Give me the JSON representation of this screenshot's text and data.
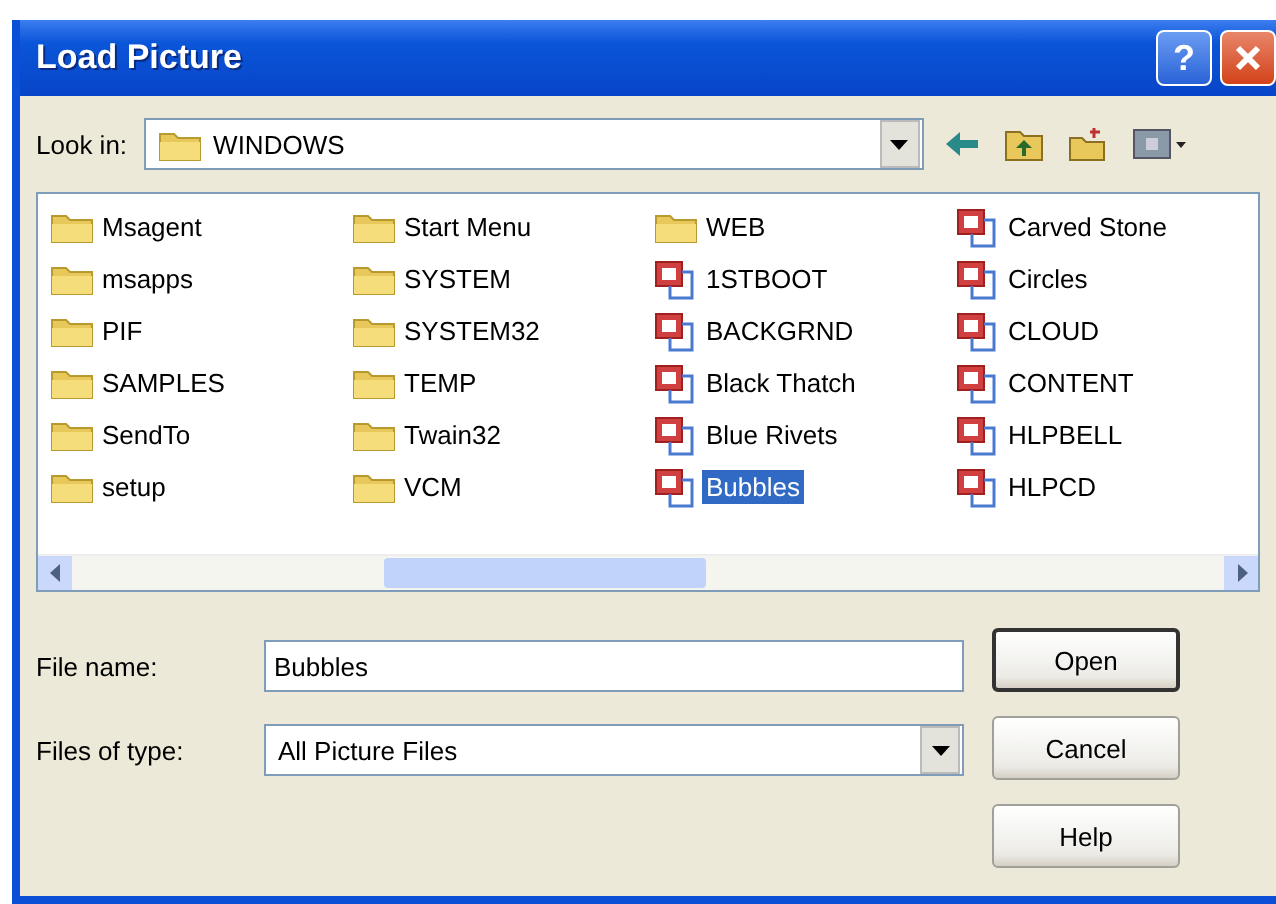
{
  "window": {
    "title": "Load Picture",
    "buttons": [
      {
        "kind": "help",
        "label": "?"
      },
      {
        "kind": "close"
      }
    ]
  },
  "toolbar": {
    "look_in_label": "Look in:",
    "look_in_value": "WINDOWS",
    "tools": [
      {
        "kind": "back"
      },
      {
        "kind": "up"
      },
      {
        "kind": "new-folder"
      },
      {
        "kind": "views"
      }
    ]
  },
  "files": [
    [
      {
        "name": "Msagent",
        "kind": "folder",
        "selected": false
      },
      {
        "name": "msapps",
        "kind": "folder",
        "selected": false
      },
      {
        "name": "PIF",
        "kind": "folder",
        "selected": false
      },
      {
        "name": "SAMPLES",
        "kind": "folder",
        "selected": false
      },
      {
        "name": "SendTo",
        "kind": "folder",
        "selected": false
      },
      {
        "name": "setup",
        "kind": "folder",
        "selected": false
      }
    ],
    [
      {
        "name": "Start Menu",
        "kind": "folder",
        "selected": false
      },
      {
        "name": "SYSTEM",
        "kind": "folder",
        "selected": false
      },
      {
        "name": "SYSTEM32",
        "kind": "folder",
        "selected": false
      },
      {
        "name": "TEMP",
        "kind": "folder",
        "selected": false
      },
      {
        "name": "Twain32",
        "kind": "folder",
        "selected": false
      },
      {
        "name": "VCM",
        "kind": "folder",
        "selected": false
      }
    ],
    [
      {
        "name": "WEB",
        "kind": "folder",
        "selected": false
      },
      {
        "name": "1STBOOT",
        "kind": "picture",
        "selected": false
      },
      {
        "name": "BACKGRND",
        "kind": "picture",
        "selected": false
      },
      {
        "name": "Black Thatch",
        "kind": "picture",
        "selected": false
      },
      {
        "name": "Blue Rivets",
        "kind": "picture",
        "selected": false
      },
      {
        "name": "Bubbles",
        "kind": "picture",
        "selected": true
      }
    ],
    [
      {
        "name": "Carved Stone",
        "kind": "picture",
        "selected": false
      },
      {
        "name": "Circles",
        "kind": "picture",
        "selected": false
      },
      {
        "name": "CLOUD",
        "kind": "picture",
        "selected": false
      },
      {
        "name": "CONTENT",
        "kind": "picture",
        "selected": false
      },
      {
        "name": "HLPBELL",
        "kind": "picture",
        "selected": false
      },
      {
        "name": "HLPCD",
        "kind": "picture",
        "selected": false
      }
    ]
  ],
  "file_name": {
    "label": "File name:",
    "value": "Bubbles"
  },
  "file_type": {
    "label": "Files of type:",
    "value": "All Picture Files"
  },
  "buttons": [
    {
      "label": "Open",
      "default": true
    },
    {
      "label": "Cancel",
      "default": false
    },
    {
      "label": "Help",
      "default": false
    }
  ]
}
